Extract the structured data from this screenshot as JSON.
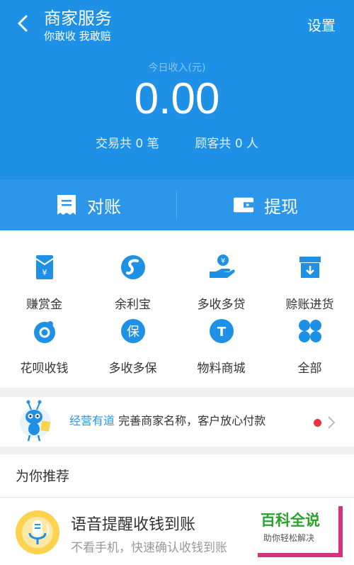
{
  "header": {
    "title": "商家服务",
    "subtitle": "你敢收 我敢赔",
    "settings_label": "设置"
  },
  "income": {
    "label": "今日收入(元)",
    "value": "0.00",
    "tx_prefix": "交易共",
    "tx_count": "0",
    "tx_suffix": "笔",
    "cust_prefix": "顾客共",
    "cust_count": "0",
    "cust_suffix": "人"
  },
  "actions": [
    {
      "label": "对账",
      "icon": "receipt-icon"
    },
    {
      "label": "提现",
      "icon": "wallet-icon"
    }
  ],
  "grid": [
    {
      "label": "赚赏金",
      "icon": "reward-envelope-icon"
    },
    {
      "label": "余利宝",
      "icon": "yulibao-icon"
    },
    {
      "label": "多收多贷",
      "icon": "loan-hand-icon"
    },
    {
      "label": "赊账进货",
      "icon": "credit-box-icon"
    },
    {
      "label": "花呗收钱",
      "icon": "huabei-icon"
    },
    {
      "label": "多收多保",
      "icon": "insurance-icon"
    },
    {
      "label": "物料商城",
      "icon": "store-t-icon"
    },
    {
      "label": "全部",
      "icon": "four-grid-icon"
    }
  ],
  "notice": {
    "highlight": "经营有道",
    "text": "完善商家名称，客户放心付款"
  },
  "recommend": {
    "title": "为你推荐",
    "item_title": "语音提醒收钱到账",
    "item_sub": "不看手机，快速确认收钱到账"
  },
  "watermark": {
    "line1": "百科全说",
    "line2": "助你轻松解决"
  },
  "colors": {
    "header_bg": "#1e90e6",
    "action_bg": "#2b96ea",
    "accent": "#2b96ea",
    "notice_dot": "#ee3338"
  }
}
